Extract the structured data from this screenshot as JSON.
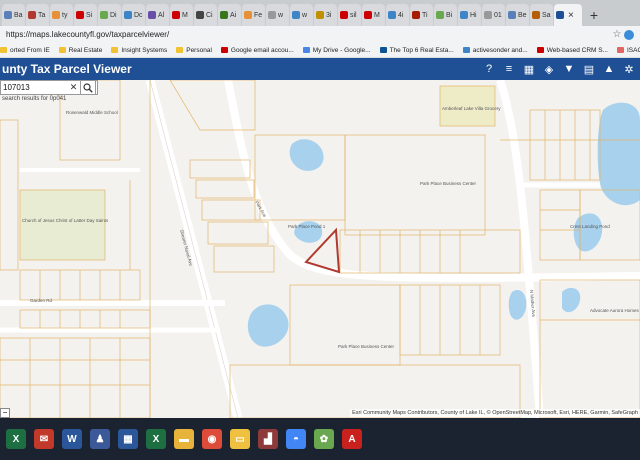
{
  "browser": {
    "tabs": [
      {
        "label": "Ba",
        "color": "#5b7fb8"
      },
      {
        "label": "Ta",
        "color": "#b03a2e"
      },
      {
        "label": "ty",
        "color": "#e69138"
      },
      {
        "label": "Si",
        "color": "#cc0000"
      },
      {
        "label": "Di",
        "color": "#6aa84f"
      },
      {
        "label": "Dc",
        "color": "#3d85c6"
      },
      {
        "label": "Al",
        "color": "#674ea7"
      },
      {
        "label": "M",
        "color": "#cc0000"
      },
      {
        "label": "Ci",
        "color": "#444444"
      },
      {
        "label": "Ai",
        "color": "#38761d"
      },
      {
        "label": "Fe",
        "color": "#e69138"
      },
      {
        "label": "w",
        "color": "#999999"
      },
      {
        "label": "w",
        "color": "#3d85c6"
      },
      {
        "label": "3i",
        "color": "#bf9000"
      },
      {
        "label": "sil",
        "color": "#cc0000"
      },
      {
        "label": "M",
        "color": "#cc0000"
      },
      {
        "label": "4i",
        "color": "#3d85c6"
      },
      {
        "label": "Ti",
        "color": "#a61c00"
      },
      {
        "label": "Bi",
        "color": "#6aa84f"
      },
      {
        "label": "Hi",
        "color": "#3d85c6"
      },
      {
        "label": "01",
        "color": "#999999"
      },
      {
        "label": "Be",
        "color": "#5b7fb8"
      },
      {
        "label": "Sa",
        "color": "#b45f06"
      }
    ],
    "active_tab_label": "",
    "new_tab": "+",
    "url": "https://maps.lakecountyfl.gov/taxparcelviewer/",
    "bookmarks": [
      {
        "label": "orted From IE",
        "color": "#f1c232"
      },
      {
        "label": "Real Estate",
        "color": "#f1c232"
      },
      {
        "label": "Insight Systems",
        "color": "#f1c232"
      },
      {
        "label": "Personal",
        "color": "#f1c232"
      },
      {
        "label": "Google email accou...",
        "color": "#cc0000"
      },
      {
        "label": "My Drive - Google...",
        "color": "#4a86e8"
      },
      {
        "label": "The Top 6 Real Esta...",
        "color": "#0b5394"
      },
      {
        "label": "activesonder and...",
        "color": "#3d85c6"
      },
      {
        "label": "Web-based CRM S...",
        "color": "#cc0000"
      },
      {
        "label": "ISACF Contact - Lo...",
        "color": "#e06666"
      }
    ]
  },
  "app": {
    "title": "unty Tax Parcel Viewer",
    "tools": [
      {
        "icon": "help-icon",
        "glyph": "?"
      },
      {
        "icon": "list-icon",
        "glyph": "≡"
      },
      {
        "icon": "grid-icon",
        "glyph": "▦"
      },
      {
        "icon": "layers-icon",
        "glyph": "◈"
      },
      {
        "icon": "filter-icon",
        "glyph": "▼"
      },
      {
        "icon": "table-icon",
        "glyph": "▤"
      },
      {
        "icon": "education-icon",
        "glyph": "▲"
      },
      {
        "icon": "settings-icon",
        "glyph": "✲"
      }
    ],
    "search": {
      "value": "107013",
      "clear": "✕",
      "hint": "search results for 0p041"
    }
  },
  "map": {
    "labels": {
      "school": "Rosenwald Middle School",
      "church": "Church of Jesus Christ of Latter Day Saints",
      "pond1": "Park Place Pond 1",
      "business_center": "Park Place Business Center",
      "business_center2": "Park Place Business Center",
      "villa": "Amberleaf Lake Villa Grocery",
      "crestlanding": "Crest Landing Pond",
      "advocate": "Advocate Aurora Homes",
      "road_shearer": "Shearer Naval Ave",
      "road_park": "Park Ave",
      "road_mather": "N Mather Ave",
      "road_garden": "Garden Rd"
    },
    "attribution": "Esri Community Maps Contributors, County of Lake IL, © OpenStreetMap, Microsoft, Esri, HERE, Garmin, SafeGraph",
    "colors": {
      "land": "#f4f2ee",
      "road": "#ffffff",
      "parcel_line": "#e2b56a",
      "water": "#a8d1ed",
      "park": "#e8ecd2",
      "highlight": "#b13a2f"
    }
  },
  "taskbar": [
    {
      "icon": "excel-icon",
      "glyph": "X",
      "color": "#1d6f42"
    },
    {
      "icon": "mail-icon",
      "glyph": "✉",
      "color": "#c0392b"
    },
    {
      "icon": "word-icon",
      "glyph": "W",
      "color": "#2b579a"
    },
    {
      "icon": "people-icon",
      "glyph": "♟",
      "color": "#3b5998"
    },
    {
      "icon": "calc-icon",
      "glyph": "▦",
      "color": "#2b579a"
    },
    {
      "icon": "sheet-icon",
      "glyph": "X",
      "color": "#1d6f42"
    },
    {
      "icon": "folder-icon",
      "glyph": "▬",
      "color": "#e8b33a"
    },
    {
      "icon": "chrome-icon",
      "glyph": "◉",
      "color": "#dd4b39"
    },
    {
      "icon": "explorer-icon",
      "glyph": "▭",
      "color": "#f0c040"
    },
    {
      "icon": "chart-icon",
      "glyph": "▟",
      "color": "#8e3a3a"
    },
    {
      "icon": "storage-icon",
      "glyph": "◓",
      "color": "#4285f4"
    },
    {
      "icon": "app-icon",
      "glyph": "✿",
      "color": "#6aa84f"
    },
    {
      "icon": "pdf-icon",
      "glyph": "A",
      "color": "#c9211e"
    }
  ]
}
